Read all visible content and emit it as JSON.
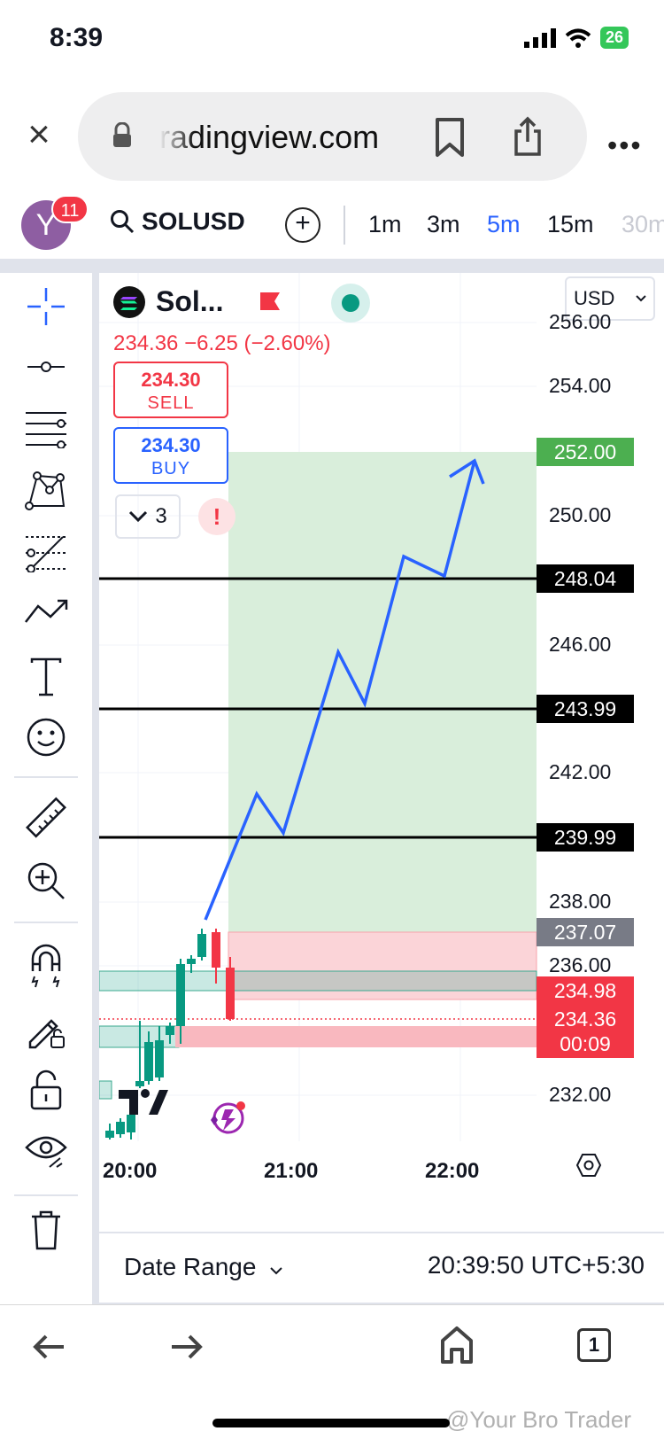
{
  "status_bar": {
    "time": "8:39",
    "battery": "26"
  },
  "browser": {
    "url": "radingview.com"
  },
  "toolbar": {
    "avatar_letter": "Y",
    "notifications": "11",
    "symbol": "SOLUSD",
    "intervals": [
      "1m",
      "3m",
      "5m",
      "15m",
      "30m"
    ],
    "active_interval": "5m"
  },
  "legend": {
    "symbol_name": "Sol...",
    "price_change": "234.36 −6.25 (−2.60%)",
    "sell_price": "234.30",
    "sell_label": "SELL",
    "buy_price": "234.30",
    "buy_label": "BUY",
    "indicator_count": "3",
    "currency": "USD"
  },
  "price_axis": {
    "labels": [
      "256.00",
      "254.00",
      "250.00",
      "246.00",
      "242.00",
      "238.00",
      "236.00",
      "232.00"
    ],
    "tags": {
      "target": "252.00",
      "level_1": "248.04",
      "level_2": "243.99",
      "level_3": "239.99",
      "stop": "237.07",
      "entry": "234.98",
      "last_price": "234.36",
      "countdown": "00:09"
    }
  },
  "time_axis": [
    "20:00",
    "21:00",
    "22:00"
  ],
  "footer": {
    "date_range": "Date Range",
    "clock": "20:39:50 UTC+5:30"
  },
  "watermark": "@Your Bro Trader",
  "colors": {
    "up": "#089981",
    "down": "#f23645",
    "accent": "#2962ff",
    "profit_zone": "#d9eedb",
    "loss_zone": "#fbd4d8",
    "stop_tag": "#787b86",
    "target_tag": "#4caf50"
  }
}
